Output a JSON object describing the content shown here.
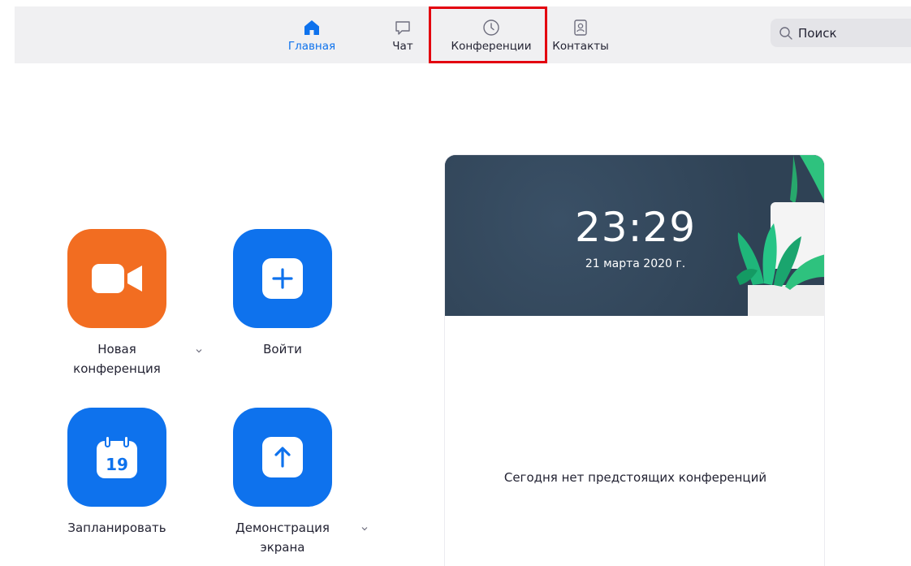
{
  "nav": {
    "tabs": [
      {
        "label": "Главная",
        "icon": "home-icon",
        "active": true
      },
      {
        "label": "Чат",
        "icon": "chat-bubble-icon",
        "active": false
      },
      {
        "label": "Конференции",
        "icon": "clock-icon",
        "active": false
      },
      {
        "label": "Контакты",
        "icon": "contact-card-icon",
        "active": false
      }
    ]
  },
  "search": {
    "placeholder": "Поиск",
    "icon": "search-icon"
  },
  "actions": {
    "new_meeting": {
      "label_line1": "Новая",
      "label_line2": "конференция",
      "icon": "video-camera-icon",
      "color": "#f26d21"
    },
    "join": {
      "label": "Войти",
      "icon": "plus-icon",
      "color": "#0e72ed"
    },
    "schedule": {
      "label": "Запланировать",
      "icon": "calendar-icon",
      "calendar_day": "19",
      "color": "#0e72ed"
    },
    "share_screen": {
      "label_line1": "Демонстрация",
      "label_line2": "экрана",
      "icon": "share-up-arrow-icon",
      "color": "#0e72ed"
    }
  },
  "panel": {
    "time": "23:29",
    "date": "21 марта 2020 г.",
    "empty_message": "Сегодня нет предстоящих конференций"
  },
  "colors": {
    "accent": "#0e72ed",
    "highlight": "#e3000f",
    "header_bg": "#33465a"
  }
}
